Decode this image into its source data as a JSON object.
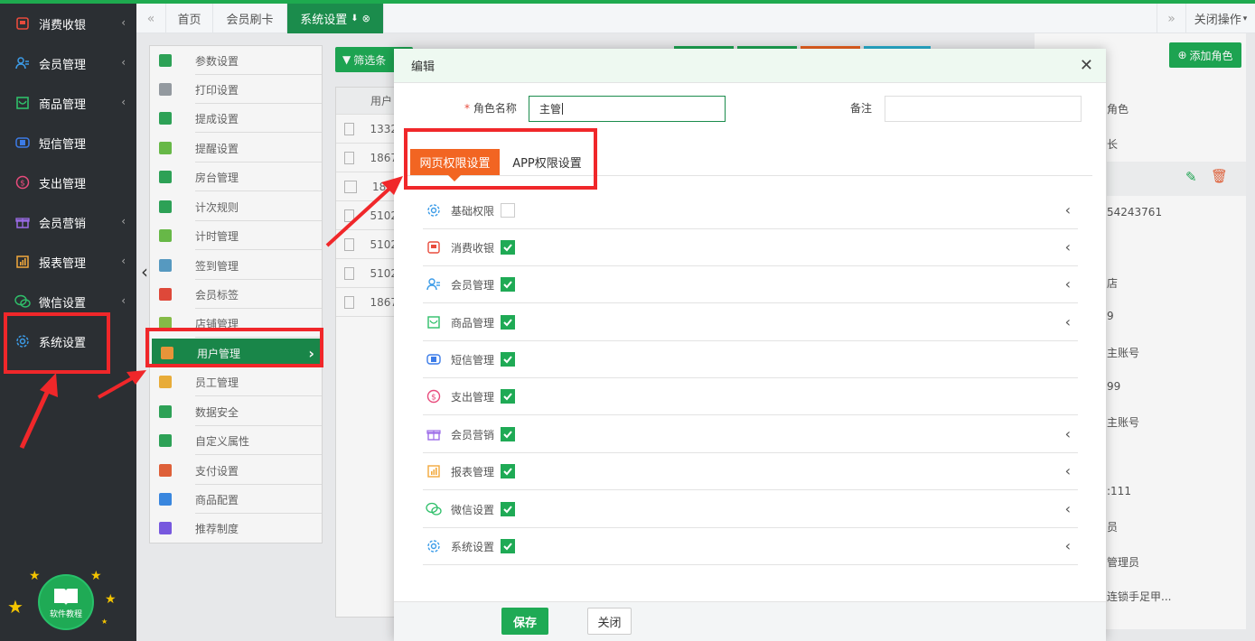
{
  "sidebar": {
    "items": [
      {
        "label": "消费收银",
        "icon": "cashier-icon"
      },
      {
        "label": "会员管理",
        "icon": "members-icon"
      },
      {
        "label": "商品管理",
        "icon": "goods-icon"
      },
      {
        "label": "短信管理",
        "icon": "sms-icon"
      },
      {
        "label": "支出管理",
        "icon": "expense-icon"
      },
      {
        "label": "会员营销",
        "icon": "gift-icon"
      },
      {
        "label": "报表管理",
        "icon": "report-icon"
      },
      {
        "label": "微信设置",
        "icon": "wechat-icon"
      },
      {
        "label": "系统设置",
        "icon": "gear-icon"
      }
    ],
    "tutorial_label": "软件教程"
  },
  "tabbar": {
    "tabs": [
      "首页",
      "会员刷卡",
      "系统设置"
    ],
    "close_ops": "关闭操作"
  },
  "submenu": {
    "items": [
      {
        "label": "参数设置",
        "color": "#2fa85a"
      },
      {
        "label": "打印设置",
        "color": "#9aa0a6"
      },
      {
        "label": "提成设置",
        "color": "#2fa85a"
      },
      {
        "label": "提醒设置",
        "color": "#6cc04a"
      },
      {
        "label": "房台管理",
        "color": "#2fa85a"
      },
      {
        "label": "计次规则",
        "color": "#2fa85a"
      },
      {
        "label": "计时管理",
        "color": "#6cc04a"
      },
      {
        "label": "签到管理",
        "color": "#5aa0c8"
      },
      {
        "label": "会员标签",
        "color": "#e84b3c"
      },
      {
        "label": "店铺管理",
        "color": "#8bc34a"
      },
      {
        "label": "用户管理",
        "color": "#f29b3c"
      },
      {
        "label": "员工管理",
        "color": "#f2b33c"
      },
      {
        "label": "数据安全",
        "color": "#2fa85a"
      },
      {
        "label": "自定义属性",
        "color": "#2fa85a"
      },
      {
        "label": "支付设置",
        "color": "#e8643c"
      },
      {
        "label": "商品配置",
        "color": "#3c8ce8"
      },
      {
        "label": "推荐制度",
        "color": "#7c5ce8"
      }
    ]
  },
  "toolbar": {
    "filter_label": "筛选条"
  },
  "list": {
    "header": "用户",
    "rows": [
      "1332",
      "1867",
      "18",
      "5102",
      "5102",
      "5102",
      "1867"
    ]
  },
  "right_panel": {
    "add_role": "添加角色",
    "rows": [
      "角色",
      "长",
      "",
      "54243761",
      "店",
      "9",
      "主账号",
      "99",
      "主账号",
      ":111",
      "员",
      "管理员",
      "连锁手足甲..."
    ]
  },
  "modal": {
    "title": "编辑",
    "role_name_label": "角色名称",
    "role_name_value": "主管",
    "remark_label": "备注",
    "remark_value": "",
    "tabs": [
      "网页权限设置",
      "APP权限设置"
    ],
    "permissions": [
      {
        "label": "基础权限",
        "icon": "gear-icon",
        "checked": false,
        "expandable": true
      },
      {
        "label": "消费收银",
        "icon": "cashier-icon",
        "checked": true,
        "expandable": true
      },
      {
        "label": "会员管理",
        "icon": "members-icon",
        "checked": true,
        "expandable": true
      },
      {
        "label": "商品管理",
        "icon": "goods-icon",
        "checked": true,
        "expandable": true
      },
      {
        "label": "短信管理",
        "icon": "sms-icon",
        "checked": true,
        "expandable": false
      },
      {
        "label": "支出管理",
        "icon": "expense-icon",
        "checked": true,
        "expandable": false
      },
      {
        "label": "会员营销",
        "icon": "gift-icon",
        "checked": true,
        "expandable": true
      },
      {
        "label": "报表管理",
        "icon": "report-icon",
        "checked": true,
        "expandable": true
      },
      {
        "label": "微信设置",
        "icon": "wechat-icon",
        "checked": true,
        "expandable": true
      },
      {
        "label": "系统设置",
        "icon": "gear-icon",
        "checked": true,
        "expandable": true
      }
    ],
    "save_label": "保存",
    "close_label": "关闭"
  },
  "colors": {
    "brand": "#1b8c4c",
    "accent": "#f26522",
    "highlight": "#f0272a"
  }
}
